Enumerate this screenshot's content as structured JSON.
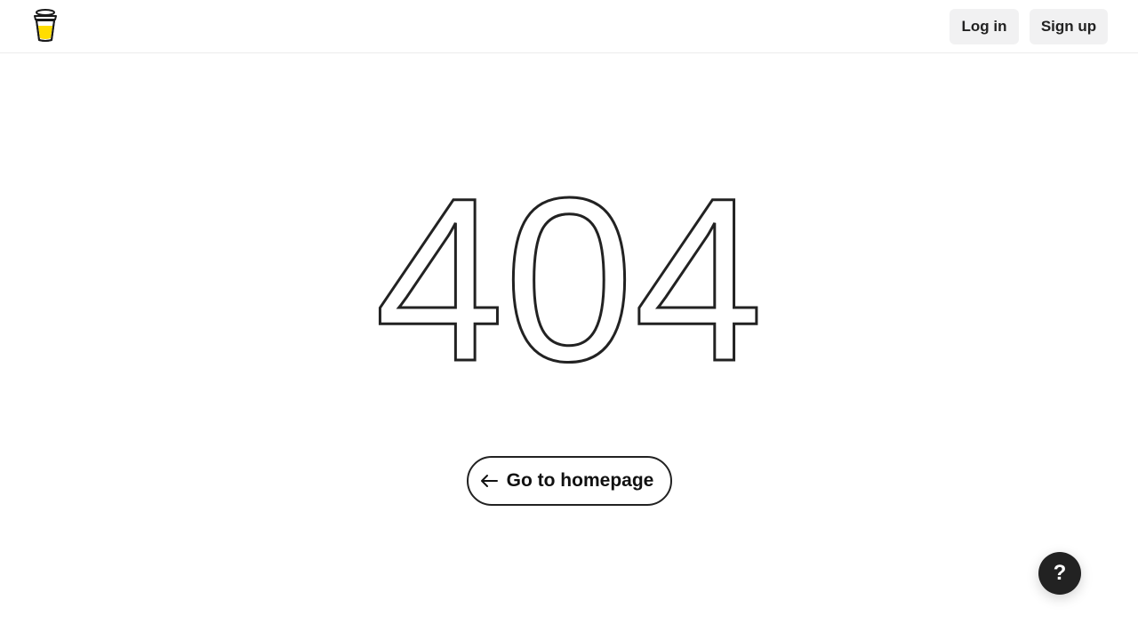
{
  "header": {
    "logo_icon": "coffee-cup-icon",
    "login_label": "Log in",
    "signup_label": "Sign up"
  },
  "main": {
    "error_code": "404",
    "home_button_label": "Go to homepage",
    "home_button_icon": "arrow-left-icon"
  },
  "help": {
    "label": "?",
    "icon": "help-icon"
  },
  "colors": {
    "text": "#222222",
    "button_bg": "#f1f1f2",
    "cup_yellow": "#ffdd00",
    "help_bg": "#222222"
  }
}
